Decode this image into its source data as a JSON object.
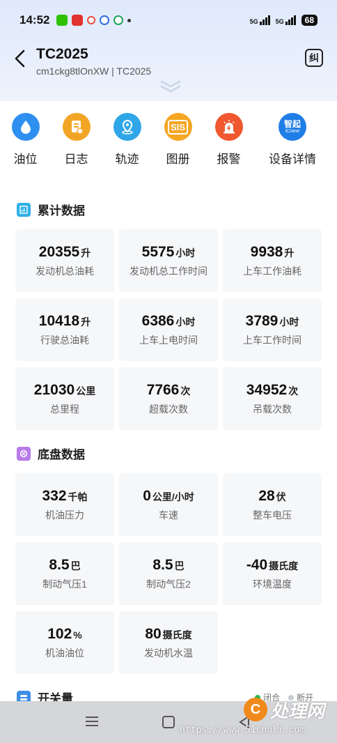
{
  "status_bar": {
    "time": "14:52",
    "network_1": "5G",
    "network_2": "5G",
    "battery": "68"
  },
  "header": {
    "title": "TC2025",
    "subtitle": "cm1ckg8tlOnXW | TC2025",
    "correction_button": "纠"
  },
  "quick_nav": [
    {
      "label": "油位",
      "icon": "oil-drop-icon",
      "color": "#2f8ff0"
    },
    {
      "label": "日志",
      "icon": "log-icon",
      "color": "#f2a524"
    },
    {
      "label": "轨迹",
      "icon": "location-pin-icon",
      "color": "#2fa6e8"
    },
    {
      "label": "图册",
      "icon": "sis-icon",
      "icon_text": "SIS",
      "color": "#f5a623"
    },
    {
      "label": "报警",
      "icon": "alarm-icon",
      "color": "#f0582f"
    },
    {
      "label": "设备详情",
      "icon": "icrane-icon",
      "icon_text": "智起",
      "icon_subtext": "iCrane",
      "color": "#1f7de6"
    }
  ],
  "cumulative": {
    "title": "累计数据",
    "cards": [
      {
        "value": "20355",
        "unit": "升",
        "label": "发动机总油耗"
      },
      {
        "value": "5575",
        "unit": "小时",
        "label": "发动机总工作时间"
      },
      {
        "value": "9938",
        "unit": "升",
        "label": "上车工作油耗"
      },
      {
        "value": "10418",
        "unit": "升",
        "label": "行驶总油耗"
      },
      {
        "value": "6386",
        "unit": "小时",
        "label": "上车上电时间"
      },
      {
        "value": "3789",
        "unit": "小时",
        "label": "上车工作时间"
      },
      {
        "value": "21030",
        "unit": "公里",
        "label": "总里程"
      },
      {
        "value": "7766",
        "unit": "次",
        "label": "超载次数"
      },
      {
        "value": "34952",
        "unit": "次",
        "label": "吊载次数"
      }
    ]
  },
  "chassis": {
    "title": "底盘数据",
    "cards": [
      {
        "value": "332",
        "unit": "千帕",
        "label": "机油压力"
      },
      {
        "value": "0",
        "unit": "公里/小时",
        "label": "车速"
      },
      {
        "value": "28",
        "unit": "伏",
        "label": "整车电压"
      },
      {
        "value": "8.5",
        "unit": "巴",
        "label": "制动气压1"
      },
      {
        "value": "8.5",
        "unit": "巴",
        "label": "制动气压2"
      },
      {
        "value": "-40",
        "unit": "摄氏度",
        "label": "环境温度"
      },
      {
        "value": "102",
        "unit": "%",
        "label": "机油油位"
      },
      {
        "value": "80",
        "unit": "摄氏度",
        "label": "发动机水温"
      }
    ]
  },
  "switch": {
    "title": "开关量",
    "legend_closed": "闭合",
    "legend_open": "断开",
    "closed_color": "#2db84d",
    "open_color": "#c8ccd4"
  },
  "watermark": {
    "brand": "处理网",
    "url": "https://www.51chuli.com"
  }
}
